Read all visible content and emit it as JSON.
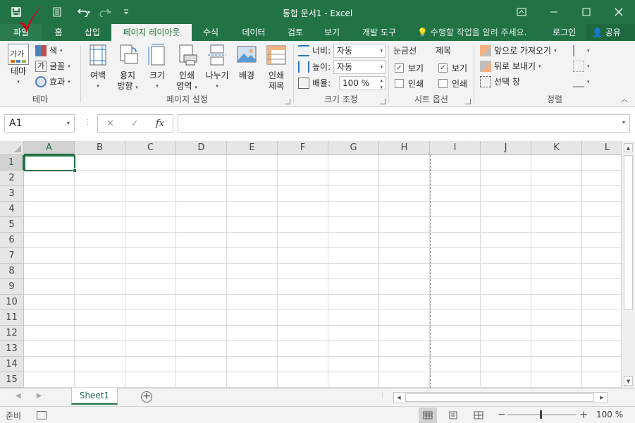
{
  "window": {
    "title": "통합 문서1 - Excel"
  },
  "ribbon_tabs": [
    {
      "label": "파일"
    },
    {
      "label": "홈"
    },
    {
      "label": "삽입"
    },
    {
      "label": "페이지 레이아웃"
    },
    {
      "label": "수식"
    },
    {
      "label": "데이터"
    },
    {
      "label": "검토"
    },
    {
      "label": "보기"
    },
    {
      "label": "개발 도구"
    }
  ],
  "tell_me": "수행할 작업을 알려 주세요.",
  "login": "로그인",
  "share": "공유",
  "groups": {
    "theme": {
      "label": "테마",
      "theme_button": "테마",
      "theme_icon_text": "가가",
      "colors": "색",
      "fonts": "글꼴",
      "fonts_icon_text": "가",
      "effects": "효과"
    },
    "page_setup": {
      "label": "페이지 설정",
      "margins": "여백",
      "orientation_1": "용지",
      "orientation_2": "방향",
      "size": "크기",
      "print_area_1": "인쇄",
      "print_area_2": "영역",
      "breaks": "나누기",
      "background": "배경",
      "print_titles_1": "인쇄",
      "print_titles_2": "제목"
    },
    "scale_to_fit": {
      "label": "크기 조정",
      "width_label": "너비:",
      "width_value": "자동",
      "height_label": "높이:",
      "height_value": "자동",
      "scale_label": "배율:",
      "scale_value": "100 %"
    },
    "sheet_options": {
      "label": "시트 옵션",
      "gridlines": "눈금선",
      "headings": "제목",
      "view": "보기",
      "print": "인쇄",
      "gridlines_view_checked": true,
      "headings_view_checked": true
    },
    "arrange": {
      "label": "정렬",
      "bring_forward": "앞으로 가져오기",
      "send_backward": "뒤로 보내기",
      "selection_pane": "선택 창"
    }
  },
  "formula_bar": {
    "name_box": "A1",
    "fx": "fx",
    "formula": ""
  },
  "grid": {
    "columns": [
      "A",
      "B",
      "C",
      "D",
      "E",
      "F",
      "G",
      "H",
      "I",
      "J",
      "K",
      "L"
    ],
    "rows": [
      "1",
      "2",
      "3",
      "4",
      "5",
      "6",
      "7",
      "8",
      "9",
      "10",
      "11",
      "12",
      "13",
      "14",
      "15"
    ],
    "active_cell": "A1"
  },
  "sheets": [
    {
      "label": "Sheet1",
      "active": true
    }
  ],
  "status_bar": {
    "status": "준비",
    "zoom": "100 %"
  },
  "colors": {
    "accent": "#217346",
    "annotation_check": "#d0021b"
  }
}
